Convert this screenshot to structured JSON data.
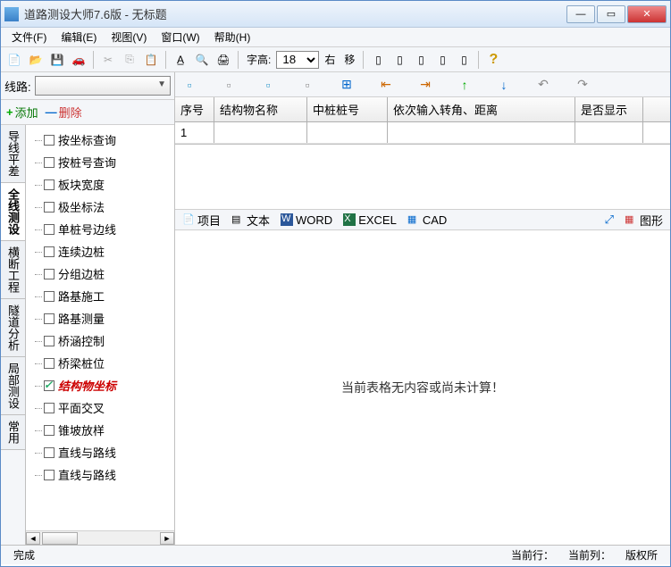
{
  "window": {
    "title": "道路测设大师7.6版 - 无标题"
  },
  "menu": {
    "file": "文件(F)",
    "edit": "编辑(E)",
    "view": "视图(V)",
    "window": "窗口(W)",
    "help": "帮助(H)"
  },
  "toolbar": {
    "fontHeightLabel": "字高:",
    "fontHeightValue": "18",
    "rightLabel": "右",
    "moveLabel": "移"
  },
  "route": {
    "label": "线路:"
  },
  "actions": {
    "add": "添加",
    "delete": "删除",
    "addSym": "+",
    "delSym": "—"
  },
  "sideTabs": [
    "导线平差",
    "全线测设",
    "横断工程",
    "隧道分析",
    "局部测设",
    "常用"
  ],
  "activeSideTab": 1,
  "treeItems": [
    {
      "label": "按坐标查询",
      "checked": false
    },
    {
      "label": "按桩号查询",
      "checked": false
    },
    {
      "label": "板块宽度",
      "checked": false
    },
    {
      "label": "极坐标法",
      "checked": false
    },
    {
      "label": "单桩号边线",
      "checked": false
    },
    {
      "label": "连续边桩",
      "checked": false
    },
    {
      "label": "分组边桩",
      "checked": false
    },
    {
      "label": "路基施工",
      "checked": false
    },
    {
      "label": "路基测量",
      "checked": false
    },
    {
      "label": "桥涵控制",
      "checked": false
    },
    {
      "label": "桥梁桩位",
      "checked": false
    },
    {
      "label": "结构物坐标",
      "checked": true,
      "selected": true
    },
    {
      "label": "平面交叉",
      "checked": false
    },
    {
      "label": "锥坡放样",
      "checked": false
    },
    {
      "label": "直线与路线",
      "checked": false
    },
    {
      "label": "直线与路线",
      "checked": false
    }
  ],
  "table": {
    "headers": {
      "seq": "序号",
      "name": "结构物名称",
      "stake": "中桩桩号",
      "input": "依次输入转角、距离",
      "show": "是否显示"
    },
    "rows": [
      {
        "seq": "1",
        "name": "",
        "stake": "",
        "input": "",
        "show": ""
      }
    ]
  },
  "export": {
    "project": "项目",
    "text": "文本",
    "word": "WORD",
    "excel": "EXCEL",
    "cad": "CAD",
    "graphic": "图形"
  },
  "content": {
    "empty": "当前表格无内容或尚未计算！"
  },
  "status": {
    "done": "完成",
    "curRow": "当前行：",
    "curCol": "当前列：",
    "copyright": "版权所"
  }
}
